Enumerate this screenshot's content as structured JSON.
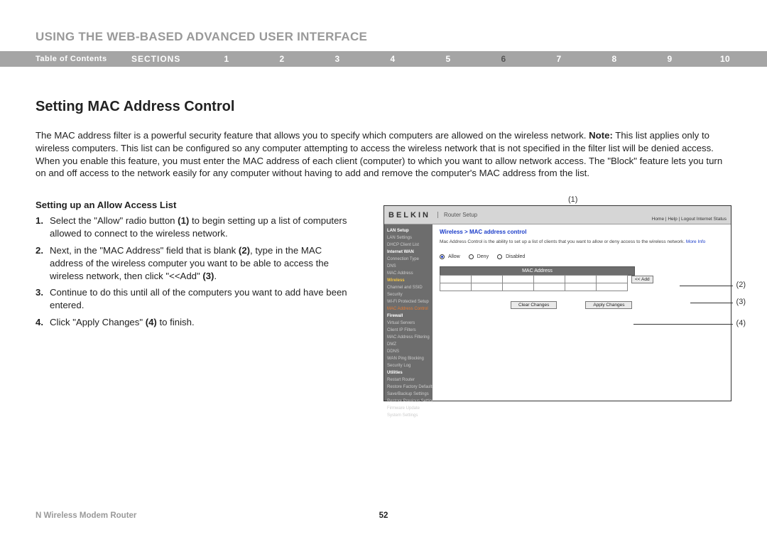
{
  "page_title": "USING THE WEB-BASED ADVANCED USER INTERFACE",
  "nav": {
    "toc": "Table of Contents",
    "sections_label": "SECTIONS",
    "numbers": [
      "1",
      "2",
      "3",
      "4",
      "5",
      "6",
      "7",
      "8",
      "9",
      "10"
    ],
    "active_index": 5
  },
  "section_title": "Setting MAC Address Control",
  "intro_pre": "The MAC address filter is a powerful security feature that allows you to specify which computers are allowed on the wireless network. ",
  "intro_bold": "Note:",
  "intro_post": " This list applies only to wireless computers. This list can be configured so any computer attempting to access the wireless network that is not specified in the filter list will be denied access. When you enable this feature, you must enter the MAC address of each client (computer) to which you want to allow network access. The \"Block\" feature lets you turn on and off access to the network easily for any computer without having to add and remove the computer's MAC address from the list.",
  "sub_title": "Setting up an Allow Access List",
  "steps": [
    {
      "n": "1.",
      "pre": "Select the \"Allow\" radio button ",
      "b": "(1)",
      "post": " to begin setting up a list of computers allowed to connect to the wireless network."
    },
    {
      "n": "2.",
      "pre": "Next, in the \"MAC Address\" field that is blank ",
      "b": "(2)",
      "post": ", type in the MAC address of the wireless computer you want to be able to access the wireless network, then click \"<<Add\" ",
      "b2": "(3)",
      "post2": "."
    },
    {
      "n": "3.",
      "pre": "Continue to do this until all of the computers you want to add have been entered.",
      "b": "",
      "post": ""
    },
    {
      "n": "4.",
      "pre": "Click \"Apply Changes\" ",
      "b": "(4)",
      "post": " to finish."
    }
  ],
  "router": {
    "brand": "BELKIN",
    "setup": "Router Setup",
    "header_links": "Home | Help | Logout  Internet Status",
    "sidebar": [
      {
        "t": "LAN Setup",
        "c": "cat"
      },
      {
        "t": "LAN Settings"
      },
      {
        "t": "DHCP Client List"
      },
      {
        "t": "Internet WAN",
        "c": "cat"
      },
      {
        "t": "Connection Type"
      },
      {
        "t": "DNS"
      },
      {
        "t": "MAC Address"
      },
      {
        "t": "Wireless",
        "c": "highlight-yellow"
      },
      {
        "t": "Channel and SSID"
      },
      {
        "t": "Security"
      },
      {
        "t": "Wi-Fi Protected Setup"
      },
      {
        "t": "MAC Address Control",
        "c": "highlight-orange"
      },
      {
        "t": "Firewall",
        "c": "cat"
      },
      {
        "t": "Virtual Servers"
      },
      {
        "t": "Client IP Filters"
      },
      {
        "t": "MAC Address Filtering"
      },
      {
        "t": "DMZ"
      },
      {
        "t": "DDNS"
      },
      {
        "t": "WAN Ping Blocking"
      },
      {
        "t": "Security Log"
      },
      {
        "t": "Utilities",
        "c": "cat"
      },
      {
        "t": "Restart Router"
      },
      {
        "t": "Restore Factory Defaults"
      },
      {
        "t": "Save/Backup Settings"
      },
      {
        "t": "Restore Previous Settings"
      },
      {
        "t": "Firmware Update"
      },
      {
        "t": "System Settings"
      }
    ],
    "crumb": "Wireless > MAC address control",
    "desc": "Mac Address Control is the ability to set up a list of clients that you want to allow or deny access to the wireless network.",
    "more": "More Info",
    "radios": {
      "allow": "Allow",
      "deny": "Deny",
      "disabled": "Disabled"
    },
    "table_header": "MAC Address",
    "add_btn": "<< Add",
    "clear_btn": "Clear Changes",
    "apply_btn": "Apply Changes"
  },
  "callouts": {
    "c1": "(1)",
    "c2": "(2)",
    "c3": "(3)",
    "c4": "(4)"
  },
  "footer_left": "N Wireless Modem Router",
  "footer_page": "52"
}
